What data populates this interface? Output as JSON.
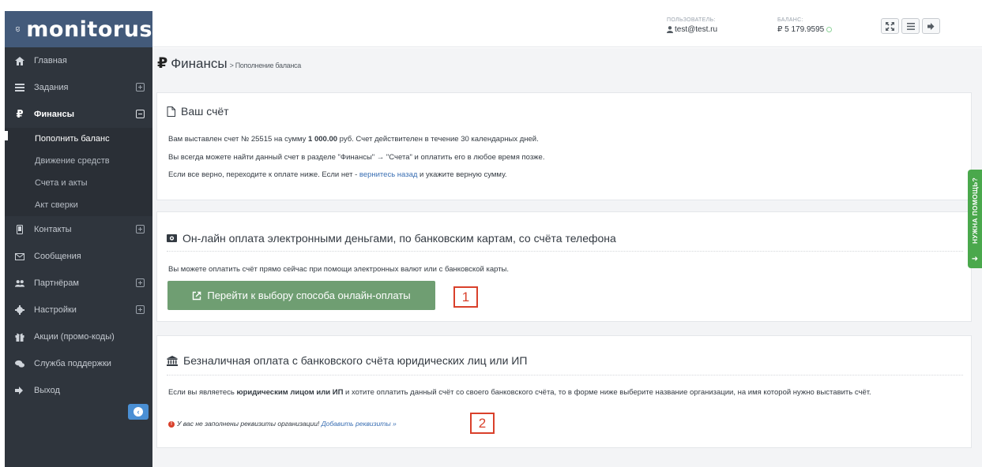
{
  "brand": {
    "name": "monitorus"
  },
  "sidebar": {
    "items": [
      {
        "label": "Главная",
        "icon": "home-icon"
      },
      {
        "label": "Задания",
        "icon": "tasks-icon"
      },
      {
        "label": "Финансы",
        "icon": "ruble-icon"
      },
      {
        "label": "Контакты",
        "icon": "phone-icon"
      },
      {
        "label": "Сообщения",
        "icon": "envelope-icon"
      },
      {
        "label": "Партнёрам",
        "icon": "users-icon"
      },
      {
        "label": "Настройки",
        "icon": "gear-icon"
      },
      {
        "label": "Акции (промо-коды)",
        "icon": "gift-icon"
      },
      {
        "label": "Служба поддержки",
        "icon": "chat-icon"
      },
      {
        "label": "Выход",
        "icon": "sign-out-icon"
      }
    ],
    "finance_sub": [
      {
        "label": "Пополнить баланс"
      },
      {
        "label": "Движение средств"
      },
      {
        "label": "Счета и акты"
      },
      {
        "label": "Акт сверки"
      }
    ]
  },
  "header": {
    "user_label": "ПОЛЬЗОВАТЕЛЬ:",
    "user_value": "test@test.ru",
    "balance_label": "БАЛАНС:",
    "balance_value": "₽ 5 179.9595"
  },
  "page": {
    "currency_symbol": "₽",
    "title": "Финансы",
    "breadcrumb": "> Пополнение баланса"
  },
  "invoice": {
    "title": "Ваш счёт",
    "line1_pre": "Вам выставлен счет № 25515 на сумму ",
    "line1_amount": "1 000.00",
    "line1_post": " руб. Счет действителен в течение 30 календарных дней.",
    "line2": "Вы всегда можете найти данный счет в разделе \"Финансы\" → \"Счета\" и оплатить его в любое время позже.",
    "line3_pre": "Если все верно, переходите к оплате ниже. Если нет - ",
    "line3_link": "вернитесь назад",
    "line3_post": " и укажите верную сумму."
  },
  "online": {
    "title": "Он-лайн оплата электронными деньгами, по банковским картам, со счёта телефона",
    "text": "Вы можете оплатить счёт прямо сейчас при помощи электронных валют или с банковской карты.",
    "button": "Перейти к выбору способа онлайн-оплаты",
    "callout": "1"
  },
  "bank": {
    "title": "Безналичная оплата с банковского счёта юридических лиц или ИП",
    "text_pre": "Если вы являетесь ",
    "text_bold": "юридическим лицом или ИП",
    "text_post": " и хотите оплатить данный счёт со своего банковского счёта, то в форме ниже выберите название организации, на имя которой нужно выставить счёт.",
    "warning": "У вас не заполнены реквизиты организации!",
    "warning_link": "Добавить реквизиты »",
    "callout": "2"
  },
  "help_tab": {
    "label": "НУЖНА ПОМОЩЬ?"
  },
  "colors": {
    "sidebar_bg": "#2f353d",
    "brand_bg": "#435a7a",
    "pay_button": "#6f9e72",
    "help_tab": "#4aa84c",
    "callout_red": "#d9402b",
    "link": "#3a6fb3"
  }
}
